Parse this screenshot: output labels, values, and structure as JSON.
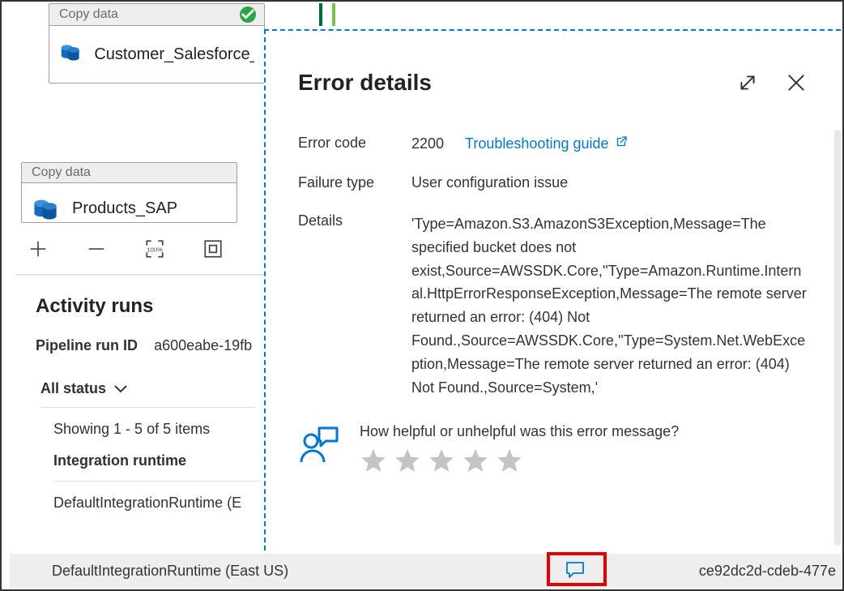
{
  "pipeline": {
    "activity1": {
      "type_label": "Copy data",
      "name": "Customer_Salesforce_copy"
    },
    "activity2": {
      "type_label": "Copy data",
      "name": "Products_SAP"
    }
  },
  "runs": {
    "section_title": "Activity runs",
    "run_id_label": "Pipeline run ID",
    "run_id_value": "a600eabe-19fb",
    "status_filter": "All status",
    "showing_text": "Showing 1 - 5 of 5 items",
    "group_label": "Integration runtime",
    "runtime1": "DefaultIntegrationRuntime (E",
    "runtime_selected": "DefaultIntegrationRuntime (East US)",
    "selected_run_guid": "ce92dc2d-cdeb-477e"
  },
  "panel": {
    "title": "Error details",
    "labels": {
      "error_code": "Error code",
      "failure_type": "Failure type",
      "details": "Details"
    },
    "error_code": "2200",
    "troubleshoot_link": "Troubleshooting guide",
    "failure_type": "User configuration issue",
    "details_text": "'Type=Amazon.S3.AmazonS3Exception,Message=The specified bucket does not exist,Source=AWSSDK.Core,''Type=Amazon.Runtime.Internal.HttpErrorResponseException,Message=The remote server returned an error: (404) Not Found.,Source=AWSSDK.Core,''Type=System.Net.WebException,Message=The remote server returned an error: (404) Not Found.,Source=System,'",
    "feedback_question": "How helpful or unhelpful was this error message?"
  }
}
